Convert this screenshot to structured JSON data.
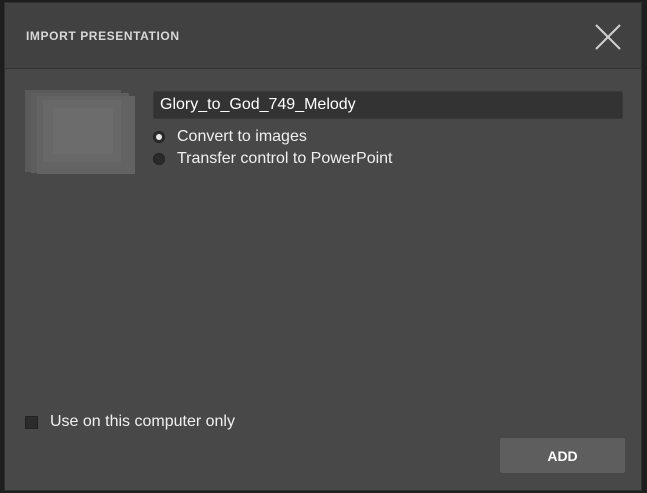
{
  "dialog": {
    "title": "IMPORT PRESENTATION",
    "close_icon": "close-icon"
  },
  "file": {
    "name": "Glory_to_God_749_Melody",
    "thumbnail_icon": "presentation-thumbnail"
  },
  "options": [
    {
      "label": "Convert to images",
      "selected": true
    },
    {
      "label": "Transfer control to PowerPoint",
      "selected": false
    }
  ],
  "local_only": {
    "label": "Use on this computer only",
    "checked": false
  },
  "actions": {
    "add_label": "ADD"
  },
  "colors": {
    "dialog_bg": "#484848",
    "header_bg": "#414141",
    "input_bg": "#333333",
    "button_bg": "#5e5e5e",
    "text": "#f0f0f0"
  }
}
